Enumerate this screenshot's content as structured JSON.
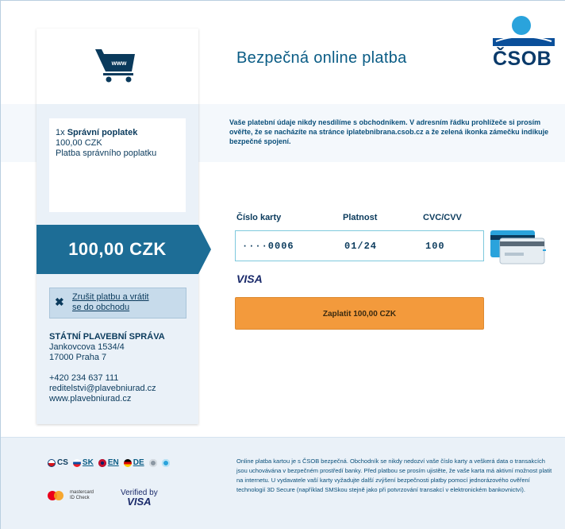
{
  "header": {
    "title": "Bezpečná online platba",
    "bank_logo": "ČSOB"
  },
  "order": {
    "item_qty": "1x",
    "item_name": "Správní poplatek",
    "item_price": "100,00 CZK",
    "item_desc": "Platba správního poplatku",
    "total": "100,00 CZK",
    "cart_label": "www"
  },
  "cancel": {
    "label_line1": "Zrušit platbu a vrátit",
    "label_line2": "se do obchodu"
  },
  "merchant": {
    "name": "STÁTNÍ PLAVEBNÍ SPRÁVA",
    "street": "Jankovcova 1534/4",
    "city": "17000 Praha 7",
    "phone": "+420 234 637 111",
    "email": "reditelstvi@plavebniurad.cz",
    "web": "www.plavebniurad.cz"
  },
  "info_text": "Vaše platební údaje nikdy nesdílíme s obchodníkem. V adresním řádku prohlížeče si prosím ověřte, že se nacházíte na stránce iplatebnibrana.csob.cz a že zelená ikonka zámečku indikuje bezpečné spojení.",
  "form": {
    "card_number_label": "Číslo karty",
    "expiry_label": "Platnost",
    "cvc_label": "CVC/CVV",
    "card_number_value": "····0006",
    "expiry_value": "01/24",
    "cvc_value": "100",
    "card_brand": "VISA",
    "pay_button": "Zaplatit 100,00 CZK"
  },
  "footer": {
    "languages": [
      {
        "code": "CS",
        "link": false
      },
      {
        "code": "SK",
        "link": true
      },
      {
        "code": "EN",
        "link": true
      },
      {
        "code": "DE",
        "link": true
      }
    ],
    "mastercard_line1": "mastercard",
    "mastercard_line2": "ID Check",
    "verified_by": "Verified by",
    "verified_visa": "VISA",
    "text": "Online platba kartou je s ČSOB bezpečná. Obchodník se nikdy nedozví vaše číslo karty a veškerá data o transakcích jsou uchovávána v bezpečném prostředí banky. Před platbou se prosím ujistěte, že vaše karta má aktivní možnost platit na internetu. U vydavatele vaší karty vyžadujte další zvýšení bezpečnosti platby pomocí jednorázového ověření technologií 3D Secure (například SMSkou stejně jako při potvrzování transakcí v elektronickém bankovnictví)."
  },
  "colors": {
    "accent": "#1d6d96",
    "pay_button": "#f39a3c",
    "panel": "#eaf1f8"
  }
}
